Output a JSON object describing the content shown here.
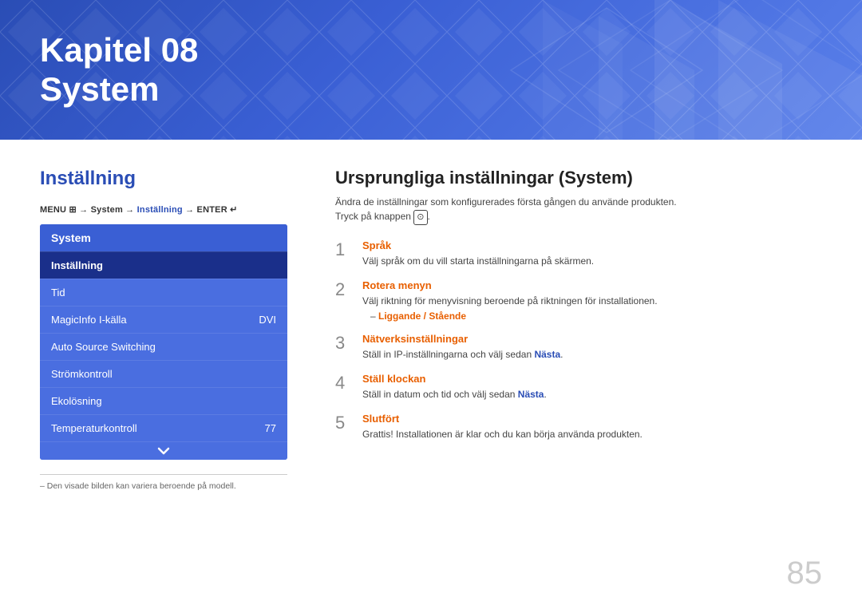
{
  "header": {
    "chapter": "Kapitel 08",
    "title": "System",
    "bg_color": "#2a4db5"
  },
  "left": {
    "section_title": "Inställning",
    "menu_path": "MENU → System → Inställning → ENTER",
    "menu_path_blue": "Inställning",
    "system_menu": {
      "header_label": "System",
      "items": [
        {
          "label": "Inställning",
          "value": "",
          "active": true
        },
        {
          "label": "Tid",
          "value": "",
          "active": false
        },
        {
          "label": "MagicInfo I-källa",
          "value": "DVI",
          "active": false
        },
        {
          "label": "Auto Source Switching",
          "value": "",
          "active": false
        },
        {
          "label": "Strömkontroll",
          "value": "",
          "active": false
        },
        {
          "label": "Ekolösning",
          "value": "",
          "active": false
        },
        {
          "label": "Temperaturkontroll",
          "value": "77",
          "active": false
        }
      ]
    },
    "footer_note": "– Den visade bilden kan variera beroende på modell."
  },
  "right": {
    "title": "Ursprungliga inställningar (System)",
    "subtitle_line1": "Ändra de inställningar som konfigurerades första gången du använde produkten.",
    "subtitle_line2": "Tryck på knappen .",
    "steps": [
      {
        "number": "1",
        "heading": "Språk",
        "desc": "Välj språk om du vill starta inställningarna på skärmen.",
        "sub": null
      },
      {
        "number": "2",
        "heading": "Rotera menyn",
        "desc": "Välj riktning för menyvisning beroende på riktningen för installationen.",
        "sub": "Liggande / Stående"
      },
      {
        "number": "3",
        "heading": "Nätverksinställningar",
        "desc_before": "Ställ in IP-inställningarna och välj sedan ",
        "desc_highlight": "Nästa",
        "desc_after": ".",
        "sub": null
      },
      {
        "number": "4",
        "heading": "Ställ klockan",
        "desc_before": "Ställ in datum och tid och välj sedan ",
        "desc_highlight": "Nästa",
        "desc_after": ".",
        "sub": null
      },
      {
        "number": "5",
        "heading": "Slutfört",
        "desc": "Grattis! Installationen är klar och du kan börja använda produkten.",
        "sub": null
      }
    ]
  },
  "page_number": "85"
}
